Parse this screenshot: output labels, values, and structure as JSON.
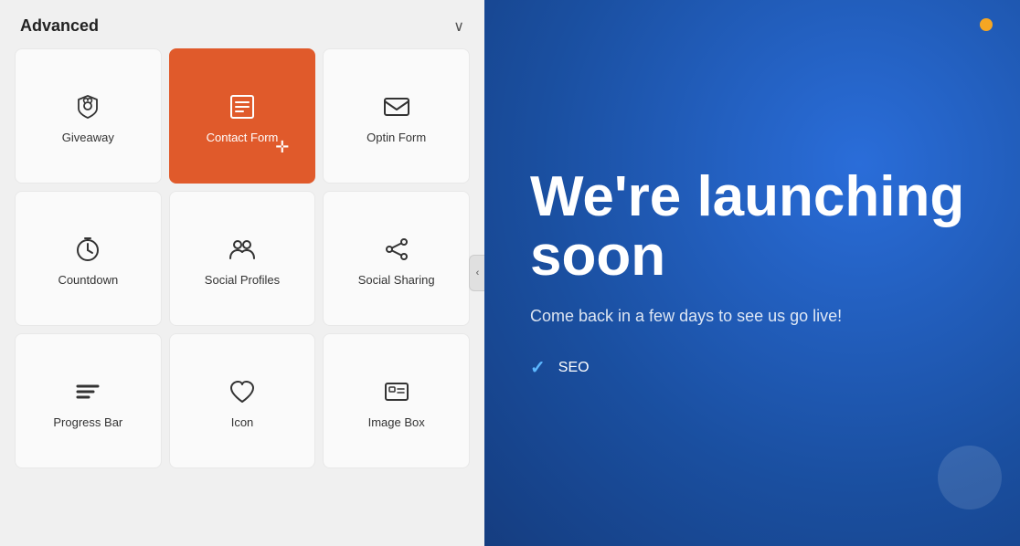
{
  "panel": {
    "title": "Advanced",
    "chevron": "∨",
    "collapse_icon": "‹"
  },
  "grid_items": [
    {
      "id": "giveaway",
      "label": "Giveaway",
      "icon": "gift",
      "active": false
    },
    {
      "id": "contact-form",
      "label": "Contact Form",
      "icon": "form",
      "active": true
    },
    {
      "id": "optin-form",
      "label": "Optin Form",
      "icon": "mail",
      "active": false
    },
    {
      "id": "countdown",
      "label": "Countdown",
      "icon": "timer",
      "active": false
    },
    {
      "id": "social-profiles",
      "label": "Social Profiles",
      "icon": "people",
      "active": false
    },
    {
      "id": "social-sharing",
      "label": "Social Sharing",
      "icon": "share",
      "active": false
    },
    {
      "id": "progress-bar",
      "label": "Progress Bar",
      "icon": "bars",
      "active": false
    },
    {
      "id": "icon",
      "label": "Icon",
      "icon": "heart",
      "active": false
    },
    {
      "id": "image-box",
      "label": "Image Box",
      "icon": "image",
      "active": false
    }
  ],
  "right_panel": {
    "heading": "We're launching soon",
    "subtext": "Come back in a few days to see us go live!",
    "features": [
      "SEO"
    ]
  }
}
